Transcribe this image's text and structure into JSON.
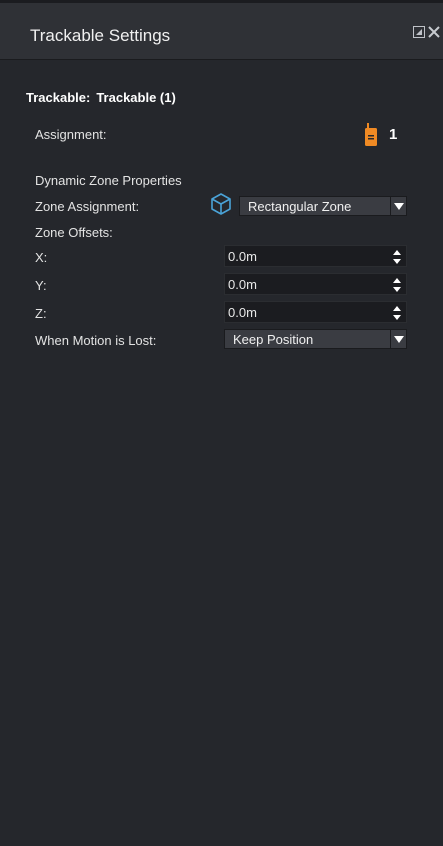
{
  "header": {
    "title": "Trackable Settings",
    "icons": [
      "popout-icon",
      "close-icon"
    ]
  },
  "trackable": {
    "label": "Trackable:",
    "name": "Trackable (1)"
  },
  "assignment": {
    "label": "Assignment:",
    "value": "1",
    "icon": "beacon-device-icon",
    "icon_color": "#f08a24"
  },
  "dynamic_zone": {
    "section_label": "Dynamic Zone Properties",
    "zone_assignment_label": "Zone Assignment:",
    "zone_icon": "cube-icon",
    "zone_icon_color": "#4aa3d8",
    "zone_selected": "Rectangular Zone",
    "zone_offsets_label": "Zone Offsets:",
    "offsets": [
      {
        "label": "X:",
        "value": "0.0m"
      },
      {
        "label": "Y:",
        "value": "0.0m"
      },
      {
        "label": "Z:",
        "value": "0.0m"
      }
    ],
    "motion_lost_label": "When Motion is Lost:",
    "motion_lost_selected": "Keep Position"
  }
}
